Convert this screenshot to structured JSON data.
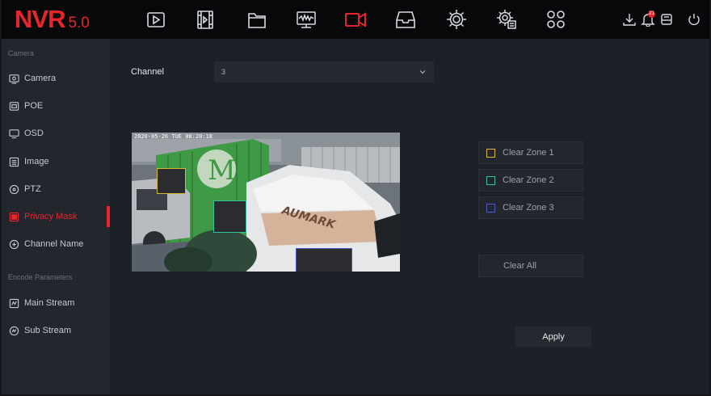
{
  "logo": {
    "brand": "NVR",
    "version": "5.0",
    "color": "#e8252b"
  },
  "topnav": [
    {
      "name": "playback-icon"
    },
    {
      "name": "video-clip-icon"
    },
    {
      "name": "folder-icon"
    },
    {
      "name": "monitor-signal-icon"
    },
    {
      "name": "camera-icon",
      "active": true
    },
    {
      "name": "inbox-icon"
    },
    {
      "name": "settings-icon"
    },
    {
      "name": "advanced-settings-icon"
    },
    {
      "name": "grid-icon"
    }
  ],
  "topright": {
    "notification_count": "21"
  },
  "sidebar": {
    "section_camera": "Camera",
    "items": [
      {
        "label": "Camera",
        "icon": "camera-icon"
      },
      {
        "label": "POE",
        "icon": "poe-icon"
      },
      {
        "label": "OSD",
        "icon": "osd-icon"
      },
      {
        "label": "Image",
        "icon": "image-icon"
      },
      {
        "label": "PTZ",
        "icon": "ptz-icon"
      },
      {
        "label": "Privacy Mask",
        "icon": "privacy-mask-icon",
        "active": true
      },
      {
        "label": "Channel Name",
        "icon": "channel-name-icon"
      }
    ],
    "section_encode": "Encode Parameters",
    "encode_items": [
      {
        "label": "Main Stream",
        "icon": "main-stream-icon"
      },
      {
        "label": "Sub Stream",
        "icon": "sub-stream-icon"
      }
    ]
  },
  "channel": {
    "label": "Channel",
    "value": "3"
  },
  "preview": {
    "osd_timestamp": "2020-05-26 TUE 08:20:18",
    "truck_text": "AUMARK",
    "container_text": "M"
  },
  "zones": [
    {
      "label": "Clear Zone 1",
      "color": "#d9b934"
    },
    {
      "label": "Clear Zone 2",
      "color": "#2fc1a1"
    },
    {
      "label": "Clear Zone 3",
      "color": "#4a5bc4"
    }
  ],
  "clear_all": "Clear All",
  "apply": "Apply"
}
